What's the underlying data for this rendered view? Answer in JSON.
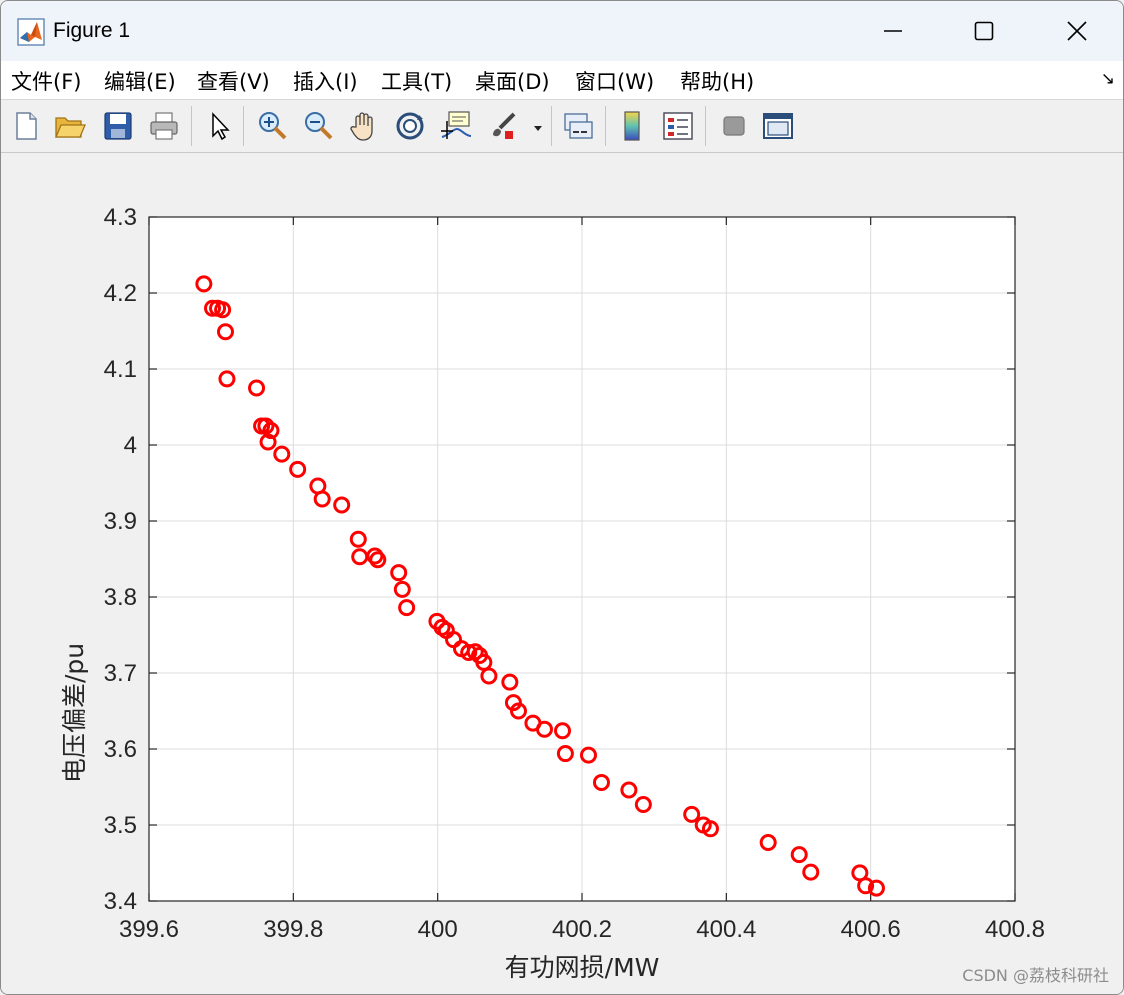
{
  "window": {
    "title": "Figure 1",
    "controls": {
      "minimize": "minimize",
      "maximize": "maximize",
      "close": "close"
    }
  },
  "menubar": {
    "items": [
      {
        "label": "文件(F)"
      },
      {
        "label": "编辑(E)"
      },
      {
        "label": "查看(V)"
      },
      {
        "label": "插入(I)"
      },
      {
        "label": "工具(T)"
      },
      {
        "label": "桌面(D)"
      },
      {
        "label": "窗口(W)"
      },
      {
        "label": "帮助(H)"
      }
    ],
    "overflow_icon": "dock-arrow-icon"
  },
  "toolbar": {
    "buttons": [
      {
        "icon": "new-figure-icon"
      },
      {
        "icon": "open-file-icon"
      },
      {
        "icon": "save-icon"
      },
      {
        "icon": "print-icon"
      },
      {
        "icon": "pointer-icon"
      },
      {
        "icon": "zoom-in-icon"
      },
      {
        "icon": "zoom-out-icon"
      },
      {
        "icon": "pan-hand-icon"
      },
      {
        "icon": "rotate-3d-icon"
      },
      {
        "icon": "data-cursor-icon"
      },
      {
        "icon": "brush-icon"
      },
      {
        "icon": "link-plot-icon"
      },
      {
        "icon": "colorbar-icon"
      },
      {
        "icon": "legend-icon"
      },
      {
        "icon": "hide-plot-tools-icon"
      },
      {
        "icon": "show-plot-tools-icon"
      }
    ]
  },
  "chart_data": {
    "type": "scatter",
    "title": "",
    "xlabel": "有功网损/MW",
    "ylabel": "电压偏差/pu",
    "xlim": [
      399.6,
      400.8
    ],
    "ylim": [
      3.4,
      4.3
    ],
    "xticks": [
      "399.6",
      "399.8",
      "400",
      "400.2",
      "400.4",
      "400.6",
      "400.8"
    ],
    "yticks": [
      "3.4",
      "3.5",
      "3.6",
      "3.7",
      "3.8",
      "3.9",
      "4",
      "4.1",
      "4.2",
      "4.3"
    ],
    "grid": true,
    "marker": "circle",
    "marker_color": "#ff0000",
    "series": [
      {
        "points": [
          [
            399.676,
            4.212
          ],
          [
            399.688,
            4.18
          ],
          [
            399.695,
            4.18
          ],
          [
            399.702,
            4.178
          ],
          [
            399.706,
            4.149
          ],
          [
            399.708,
            4.087
          ],
          [
            399.749,
            4.075
          ],
          [
            399.756,
            4.025
          ],
          [
            399.762,
            4.025
          ],
          [
            399.765,
            4.004
          ],
          [
            399.769,
            4.019
          ],
          [
            399.784,
            3.988
          ],
          [
            399.806,
            3.968
          ],
          [
            399.834,
            3.946
          ],
          [
            399.84,
            3.929
          ],
          [
            399.867,
            3.921
          ],
          [
            399.89,
            3.876
          ],
          [
            399.892,
            3.853
          ],
          [
            399.913,
            3.854
          ],
          [
            399.917,
            3.849
          ],
          [
            399.946,
            3.832
          ],
          [
            399.951,
            3.81
          ],
          [
            399.957,
            3.786
          ],
          [
            399.999,
            3.768
          ],
          [
            400.006,
            3.76
          ],
          [
            400.012,
            3.756
          ],
          [
            400.022,
            3.744
          ],
          [
            400.033,
            3.732
          ],
          [
            400.043,
            3.727
          ],
          [
            400.052,
            3.728
          ],
          [
            400.058,
            3.723
          ],
          [
            400.064,
            3.714
          ],
          [
            400.071,
            3.696
          ],
          [
            400.1,
            3.688
          ],
          [
            400.105,
            3.661
          ],
          [
            400.112,
            3.65
          ],
          [
            400.132,
            3.634
          ],
          [
            400.148,
            3.626
          ],
          [
            400.173,
            3.624
          ],
          [
            400.177,
            3.594
          ],
          [
            400.209,
            3.592
          ],
          [
            400.227,
            3.556
          ],
          [
            400.265,
            3.546
          ],
          [
            400.285,
            3.527
          ],
          [
            400.352,
            3.514
          ],
          [
            400.368,
            3.5
          ],
          [
            400.378,
            3.495
          ],
          [
            400.458,
            3.477
          ],
          [
            400.501,
            3.461
          ],
          [
            400.517,
            3.438
          ],
          [
            400.585,
            3.437
          ],
          [
            400.593,
            3.42
          ],
          [
            400.608,
            3.417
          ]
        ]
      }
    ]
  },
  "watermark": "CSDN @荔枝科研社"
}
